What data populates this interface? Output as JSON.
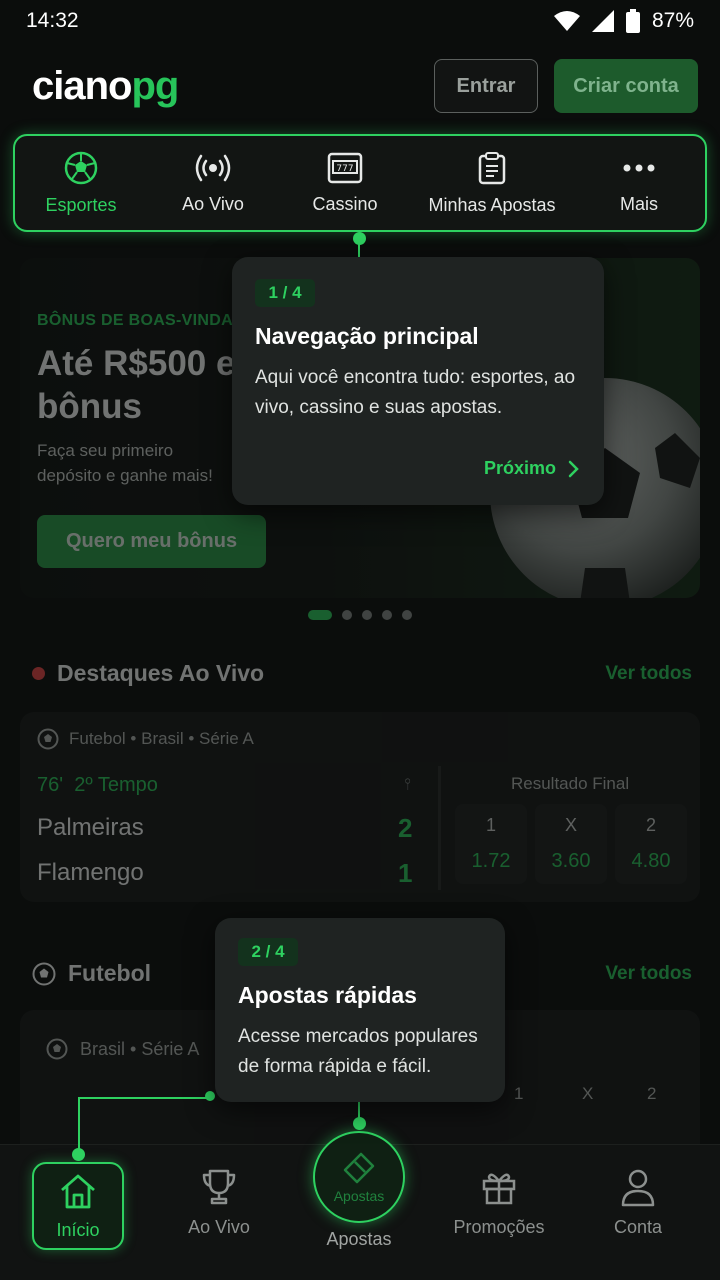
{
  "status_bar": {
    "time": "14:32",
    "battery": "87%"
  },
  "header": {
    "logo_white": "ciano",
    "logo_green": "pg",
    "login_label": "Entrar",
    "signup_label": "Criar conta"
  },
  "main_nav": {
    "items": [
      {
        "label": "Esportes",
        "icon": "soccer-ball-icon",
        "active": true
      },
      {
        "label": "Ao Vivo",
        "icon": "live-broadcast-icon"
      },
      {
        "label": "Cassino",
        "icon": "slot-machine-icon"
      },
      {
        "label": "Minhas Apostas",
        "icon": "clipboard-icon"
      },
      {
        "label": "Mais",
        "icon": "more-dots-icon"
      }
    ]
  },
  "banner": {
    "tag": "BÔNUS DE BOAS-VINDAS",
    "title": "Até R$500 em bônus",
    "description": "Faça seu primeiro depósito e ganhe mais!",
    "cta": "Quero meu bônus",
    "slides": 5,
    "active_slide": 1
  },
  "live_section": {
    "title": "Destaques Ao Vivo",
    "see_all": "Ver todos",
    "match": {
      "league": "Futebol • Brasil • Série A",
      "minute": "76'",
      "period": "2º Tempo",
      "stats_icon": "⫯",
      "home_team": "Palmeiras",
      "away_team": "Flamengo",
      "home_score": "2",
      "away_score": "1",
      "market": "Resultado Final",
      "odds": [
        {
          "key": "1",
          "value": "1.72"
        },
        {
          "key": "X",
          "value": "3.60"
        },
        {
          "key": "2",
          "value": "4.80"
        }
      ]
    }
  },
  "football_section": {
    "title": "Futebol",
    "see_all": "Ver todos",
    "league": "Brasil • Série A",
    "odds_headers": [
      "1",
      "X",
      "2"
    ]
  },
  "tooltips": [
    {
      "step": "1 / 4",
      "title": "Navegação principal",
      "description": "Aqui você encontra tudo: esportes, ao vivo, cassino e suas apostas.",
      "next": "Próximo"
    },
    {
      "step": "2 / 4",
      "title": "Apostas rápidas",
      "description": "Acesse mercados populares de forma rápida e fácil."
    }
  ],
  "bottom_nav": {
    "home": "Início",
    "live": "Ao Vivo",
    "bets": "Apostas",
    "bets_inner": "Apostas",
    "promos": "Promoções",
    "account": "Conta"
  },
  "colors": {
    "accent": "#2ed160",
    "background": "#0b0d0c",
    "live": "#f04848"
  }
}
